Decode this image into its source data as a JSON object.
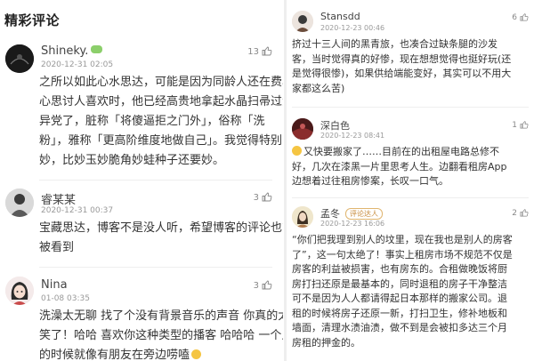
{
  "section_title": "精彩评论",
  "left_comments": [
    {
      "name": "Shineky.",
      "time": "2020-12-31 02:05",
      "likes": "13",
      "lines": [
        "之所以如此心水思达，可能是因为同龄人还在费尽",
        "心思讨人喜欢时，他已经高贵地拿起水晶扫帚过滤",
        "异党了，脏称「将傻逼拒之门外」，俗称「洗",
        "粉」，雅称「更高阶维度地做自己」。我觉得特别",
        "妙，比妙玉妙脆角妙蛙种子还要妙。"
      ]
    },
    {
      "name": "睿某某",
      "time": "2020-12-31 00:37",
      "likes": "3",
      "lines": [
        "宝藏思达，博客不是没人听，希望博客的评论也能",
        "被看到"
      ]
    },
    {
      "name": "Nina",
      "time": "01-08 03:35",
      "likes": "3",
      "lines": [
        "洗澡太无聊 找了个没有背景音乐的声音 你真的太好",
        "笑了！哈哈 喜欢你这种类型的播客 哈哈哈 一个人",
        "的时候就像有朋友在旁边唠嗑"
      ]
    }
  ],
  "right_comments": [
    {
      "name": "Stansdd",
      "time": "2020-12-23 00:46",
      "likes": "6",
      "lines": [
        "挤过十三人间的黑青旅，也凑合过缺条腿的沙发",
        "客，当时觉得真的好惨，现在想想觉得也挺好玩(还",
        "是觉得很惨)，如果供给端能变好，其实可以不用大",
        "家都这么苦)"
      ]
    },
    {
      "name": "深白色",
      "time": "2020-12-23 08:41",
      "likes": "1",
      "lines": [
        "又快要搬家了……目前在的出租屋电路总修不",
        "好，几次在漆黑一片里思考人生。边翻看租房App",
        "边想着过往租房惨案，长叹一口气。"
      ]
    },
    {
      "name": "孟冬",
      "badge": "评论达人",
      "time": "2020-12-23 16:06",
      "likes": "2",
      "lines": [
        "“你们把我理到别人的坟里，现在我也是别人的房客",
        "了”，这一句太绝了！事实上租房市场不规范不仅是",
        "房客的利益被损害，也有房东的。合租做晚饭将厨",
        "房打扫还原是最基本的，同时退租的房子干净整洁",
        "可不是因为人人都请得起日本那样的搬家公司。退",
        "租的时候将房子还原一新，打扫卫生，修补地板和",
        "墙面，清理水渍油渍，做不到是会被扣多达三个月",
        "房租的押金的。"
      ]
    }
  ],
  "colors": {
    "vip_badge": "#8ccf6b",
    "expert_badge": "#c78a3a",
    "emoji": "#f5c542"
  },
  "icons": [
    "thumb-up-icon",
    "vip-badge-icon",
    "emoji-icon"
  ]
}
